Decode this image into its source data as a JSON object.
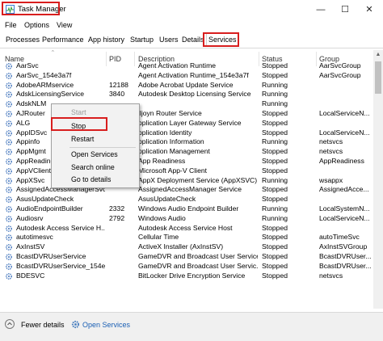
{
  "window": {
    "title": "Task Manager",
    "minimize": "—",
    "maximize": "☐",
    "close": "✕"
  },
  "menu": [
    "File",
    "Options",
    "View"
  ],
  "tabs": [
    "Processes",
    "Performance",
    "App history",
    "Startup",
    "Users",
    "Details",
    "Services"
  ],
  "active_tab": "Services",
  "columns": [
    "Name",
    "PID",
    "Description",
    "Status",
    "Group"
  ],
  "rows": [
    {
      "name": "AarSvc",
      "pid": "",
      "desc": "Agent Activation Runtime",
      "status": "Stopped",
      "group": "AarSvcGroup"
    },
    {
      "name": "AarSvc_154e3a7f",
      "pid": "",
      "desc": "Agent Activation Runtime_154e3a7f",
      "status": "Stopped",
      "group": "AarSvcGroup"
    },
    {
      "name": "AdobeARMservice",
      "pid": "12188",
      "desc": "Adobe Acrobat Update Service",
      "status": "Running",
      "group": ""
    },
    {
      "name": "AdskLicensingService",
      "pid": "3840",
      "desc": "Autodesk Desktop Licensing Service",
      "status": "Running",
      "group": ""
    },
    {
      "name": "AdskNLM",
      "pid": "",
      "desc": "",
      "status": "Running",
      "group": ""
    },
    {
      "name": "AJRouter",
      "pid": "",
      "desc": "lljoyn Router Service",
      "status": "Stopped",
      "group": "LocalServiceN..."
    },
    {
      "name": "ALG",
      "pid": "",
      "desc": "pplication Layer Gateway Service",
      "status": "Stopped",
      "group": ""
    },
    {
      "name": "AppIDSvc",
      "pid": "",
      "desc": "pplication Identity",
      "status": "Stopped",
      "group": "LocalServiceN..."
    },
    {
      "name": "Appinfo",
      "pid": "",
      "desc": "pplication Information",
      "status": "Running",
      "group": "netsvcs"
    },
    {
      "name": "AppMgmt",
      "pid": "",
      "desc": "pplication Management",
      "status": "Stopped",
      "group": "netsvcs"
    },
    {
      "name": "AppReadiness",
      "pid": "",
      "desc": "App Readiness",
      "status": "Stopped",
      "group": "AppReadiness"
    },
    {
      "name": "AppVClient",
      "pid": "",
      "desc": "Microsoft App-V Client",
      "status": "Stopped",
      "group": ""
    },
    {
      "name": "AppXSvc",
      "pid": "7844",
      "desc": "AppX Deployment Service (AppXSVC)",
      "status": "Running",
      "group": "wsappx"
    },
    {
      "name": "AssignedAccessManagerSvc",
      "pid": "",
      "desc": "AssignedAccessManager Service",
      "status": "Stopped",
      "group": "AssignedAcce..."
    },
    {
      "name": "AsusUpdateCheck",
      "pid": "",
      "desc": "AsusUpdateCheck",
      "status": "Stopped",
      "group": ""
    },
    {
      "name": "AudioEndpointBuilder",
      "pid": "2332",
      "desc": "Windows Audio Endpoint Builder",
      "status": "Running",
      "group": "LocalSystemN..."
    },
    {
      "name": "Audiosrv",
      "pid": "2792",
      "desc": "Windows Audio",
      "status": "Running",
      "group": "LocalServiceN..."
    },
    {
      "name": "Autodesk Access Service H...",
      "pid": "",
      "desc": "Autodesk Access Service Host",
      "status": "Stopped",
      "group": ""
    },
    {
      "name": "autotimesvc",
      "pid": "",
      "desc": "Cellular Time",
      "status": "Stopped",
      "group": "autoTimeSvc"
    },
    {
      "name": "AxInstSV",
      "pid": "",
      "desc": "ActiveX Installer (AxInstSV)",
      "status": "Stopped",
      "group": "AxInstSVGroup"
    },
    {
      "name": "BcastDVRUserService",
      "pid": "",
      "desc": "GameDVR and Broadcast User Service",
      "status": "Stopped",
      "group": "BcastDVRUser..."
    },
    {
      "name": "BcastDVRUserService_154e3...",
      "pid": "",
      "desc": "GameDVR and Broadcast User Servic...",
      "status": "Stopped",
      "group": "BcastDVRUser..."
    },
    {
      "name": "BDESVC",
      "pid": "",
      "desc": "BitLocker Drive Encryption Service",
      "status": "Stopped",
      "group": "netsvcs"
    }
  ],
  "context_menu": {
    "start": "Start",
    "stop": "Stop",
    "restart": "Restart",
    "open_services": "Open Services",
    "search_online": "Search online",
    "go_to_details": "Go to details"
  },
  "footer": {
    "fewer_details": "Fewer details",
    "open_services": "Open Services"
  },
  "colors": {
    "highlight_red": "#d81e1e",
    "selection": "#cce8ff",
    "link": "#1a5fb4"
  }
}
